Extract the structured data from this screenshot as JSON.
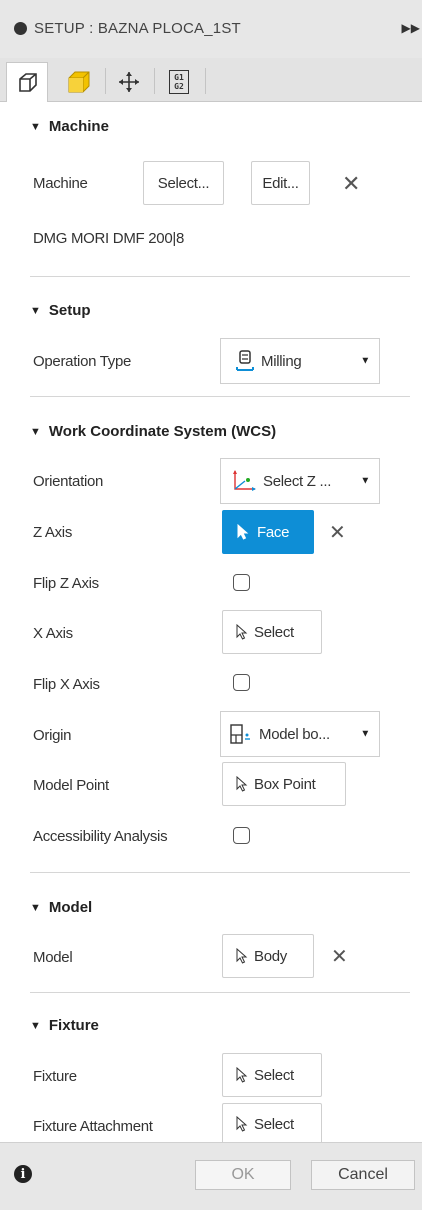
{
  "window": {
    "title": "SETUP : BAZNA PLOCA_1ST"
  },
  "tabs": [
    {
      "icon": "setup-cube-icon"
    },
    {
      "icon": "stock-box-icon"
    },
    {
      "icon": "move-arrows-icon"
    },
    {
      "icon": "gcode-icon",
      "text": "G1 G2"
    }
  ],
  "machine": {
    "section_title": "Machine",
    "label": "Machine",
    "select_label": "Select...",
    "edit_label": "Edit...",
    "clear_label": "✕",
    "machine_name": "DMG MORI DMF 200|8"
  },
  "setup": {
    "section_title": "Setup",
    "operation_type_label": "Operation Type",
    "operation_type_value": "Milling"
  },
  "wcs": {
    "section_title": "Work Coordinate System (WCS)",
    "orientation_label": "Orientation",
    "orientation_value": "Select Z ...",
    "z_axis_label": "Z Axis",
    "z_axis_value": "Face",
    "flip_z_label": "Flip Z Axis",
    "x_axis_label": "X Axis",
    "x_axis_value": "Select",
    "flip_x_label": "Flip X Axis",
    "origin_label": "Origin",
    "origin_value": "Model bo...",
    "model_point_label": "Model Point",
    "model_point_value": "Box Point",
    "accessibility_label": "Accessibility Analysis",
    "flip_z_checked": false,
    "flip_x_checked": false,
    "accessibility_checked": false
  },
  "model": {
    "section_title": "Model",
    "label": "Model",
    "value": "Body"
  },
  "fixture": {
    "section_title": "Fixture",
    "fixture_label": "Fixture",
    "fixture_value": "Select",
    "attachment_label": "Fixture Attachment",
    "attachment_value": "Select"
  },
  "footer": {
    "ok_label": "OK",
    "cancel_label": "Cancel"
  },
  "colors": {
    "accent": "#0e8ed6",
    "stock_yellow": "#f2c200"
  }
}
